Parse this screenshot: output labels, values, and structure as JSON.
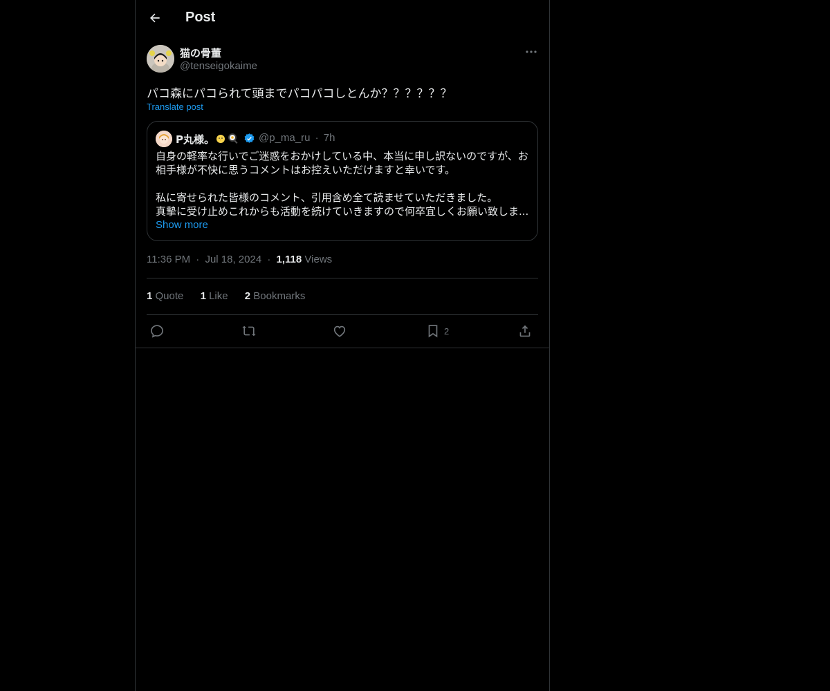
{
  "header": {
    "title": "Post",
    "back_icon": "arrow-left-icon"
  },
  "post": {
    "author_name": "猫の骨董",
    "author_handle": "@tenseigokaime",
    "text": "パコ森にパコられて頭までパコパコしとんか？？？？？？",
    "translate_label": "Translate post",
    "time": "11:36 PM",
    "date": "Jul 18, 2024",
    "views_count": "1,118",
    "views_label": "Views",
    "separator": "·"
  },
  "quote": {
    "name": "P丸様。",
    "emojis": [
      "chick-emoji",
      "egg-pan-emoji"
    ],
    "verified_icon": "verified-badge-icon",
    "handle": "@p_ma_ru",
    "time": "7h",
    "separator": "·",
    "lines": [
      "自身の軽率な行いでご迷惑をおかけしている中、本当に申し訳ないのですが、お",
      "相手様が不快に思うコメントはお控えいただけますと幸いです。",
      "",
      "私に寄せられた皆様のコメント、引用含め全て読ませていただきました。",
      "真摯に受け止めこれからも活動を続けていきますので何卒宜しくお願い致しま..."
    ],
    "show_more": "Show more"
  },
  "stats": [
    {
      "count": "1",
      "label": "Quote"
    },
    {
      "count": "1",
      "label": "Like"
    },
    {
      "count": "2",
      "label": "Bookmarks"
    }
  ],
  "actions": {
    "reply_icon": "reply-icon",
    "repost_icon": "repost-icon",
    "like_icon": "heart-icon",
    "bookmark_icon": "bookmark-icon",
    "bookmark_count": "2",
    "share_icon": "share-icon"
  },
  "colors": {
    "background": "#000000",
    "text": "#e7e9ea",
    "muted": "#71767b",
    "accent": "#1d9bf0",
    "border": "#2f3336"
  }
}
